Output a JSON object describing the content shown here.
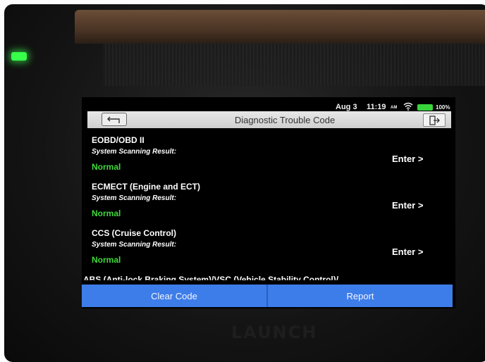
{
  "device": {
    "brand": "LAUNCH"
  },
  "status": {
    "date": "Aug 3",
    "time": "11:19",
    "ampm": "AM",
    "battery": "100%"
  },
  "header": {
    "title": "Diagnostic Trouble Code"
  },
  "systems": [
    {
      "name": "EOBD/OBD II",
      "label": "System Scanning Result:",
      "result": "Normal",
      "action": "Enter >"
    },
    {
      "name": "ECMECT (Engine and ECT)",
      "label": "System Scanning Result:",
      "result": "Normal",
      "action": "Enter >"
    },
    {
      "name": "CCS (Cruise Control)",
      "label": "System Scanning Result:",
      "result": "Normal",
      "action": "Enter >"
    }
  ],
  "partial_row": "ABS (Anti-lock Braking System)/VSC (Vehicle Stability Control)/...",
  "footer": {
    "clear_label": "Clear Code",
    "report_label": "Report"
  },
  "colors": {
    "accent": "#3d7de9",
    "status_ok": "#3fd73a"
  },
  "icons": {
    "back": "back-arrow-icon",
    "exit": "exit-icon",
    "wifi": "wifi-icon",
    "battery": "battery-icon"
  }
}
